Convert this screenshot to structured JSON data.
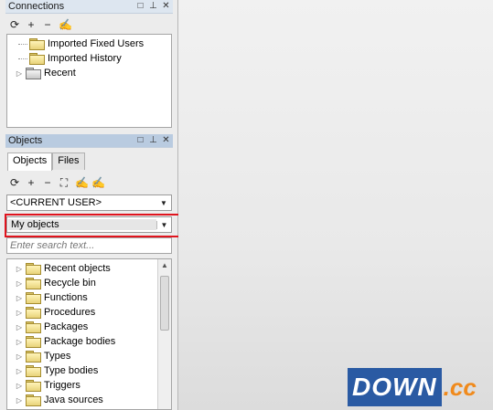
{
  "connections": {
    "title": "Connections",
    "tree": [
      {
        "label": "Imported Fixed Users",
        "icon": "folder-icon"
      },
      {
        "label": "Imported History",
        "icon": "folder-icon"
      },
      {
        "label": "Recent",
        "icon": "folder-icon"
      }
    ]
  },
  "header_icons": {
    "restore": "□",
    "pin": "⊥",
    "close": "✕"
  },
  "objects": {
    "title": "Objects",
    "tabs": [
      "Objects",
      "Files"
    ],
    "user_dropdown": "<CURRENT USER>",
    "filter_dropdown": "My objects",
    "search_placeholder": "Enter search text...",
    "tree": [
      "Recent objects",
      "Recycle bin",
      "Functions",
      "Procedures",
      "Packages",
      "Package bodies",
      "Types",
      "Type bodies",
      "Triggers",
      "Java sources"
    ]
  },
  "toolbar_icons": {
    "refresh": "⟳",
    "add": "+",
    "remove": "−",
    "find": "⛶",
    "filter": "✍",
    "lock": "🔒"
  },
  "watermark": {
    "down": "DOWN",
    "cc": ".cc"
  },
  "colors": {
    "accent": "#e0141e",
    "header": "#b9cbe0",
    "watermark_blue": "#2a5aa3",
    "watermark_orange": "#f08a1c"
  }
}
